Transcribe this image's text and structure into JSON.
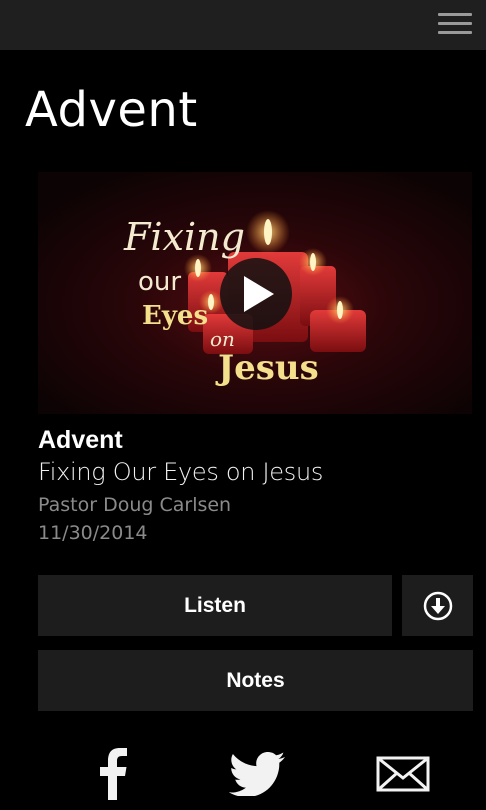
{
  "header": {
    "menu_icon": "hamburger-menu-icon"
  },
  "page": {
    "title": "Advent"
  },
  "media": {
    "artwork_line1": "Fixing",
    "artwork_line2": "our",
    "artwork_line3": "Eyes",
    "artwork_line4": "on",
    "artwork_line5": "Jesus",
    "play_icon": "play-icon"
  },
  "sermon": {
    "series": "Advent",
    "title": "Fixing Our Eyes on Jesus",
    "speaker": "Pastor Doug Carlsen",
    "date": "11/30/2014"
  },
  "actions": {
    "listen_label": "Listen",
    "download_icon": "download-icon",
    "notes_label": "Notes"
  },
  "share": {
    "facebook_icon": "facebook-icon",
    "twitter_icon": "twitter-icon",
    "email_icon": "email-icon"
  },
  "colors": {
    "background": "#000000",
    "topbar": "#1f1f1f",
    "button": "#1d1d1d",
    "muted_text": "#8a8a8a",
    "artwork_gold": "#f3df8c"
  }
}
